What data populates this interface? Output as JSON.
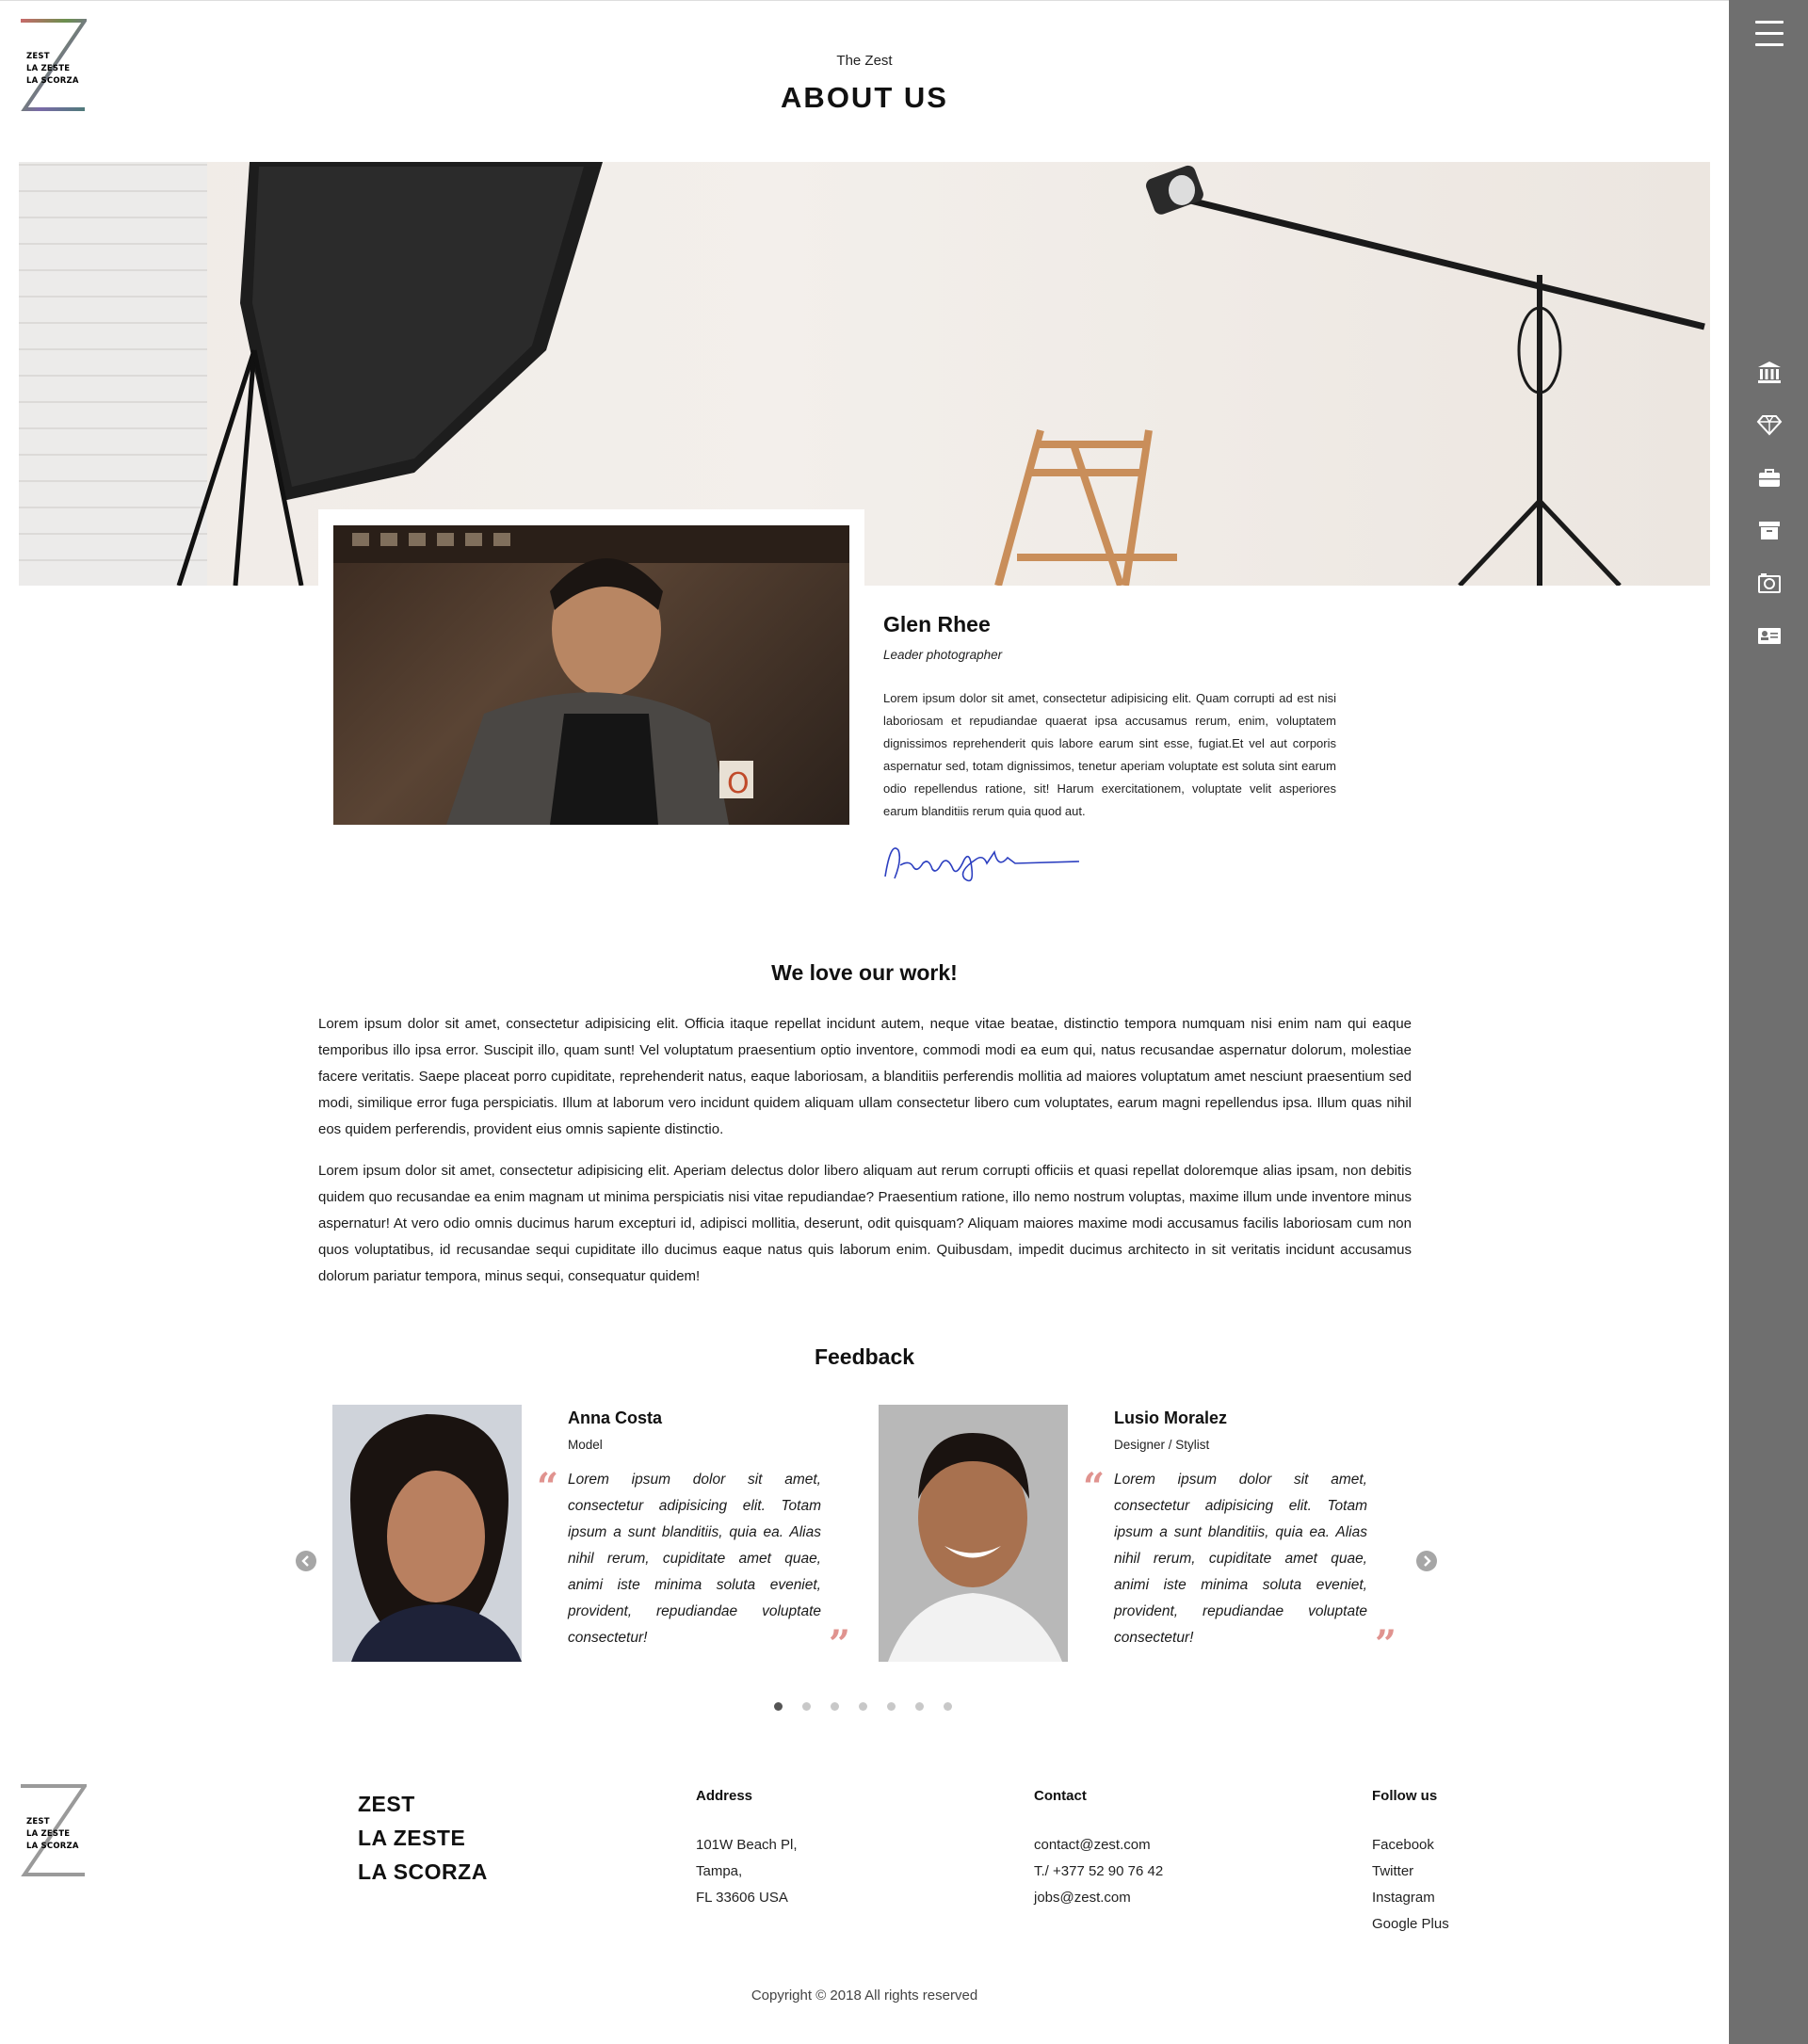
{
  "logo": {
    "line1": "ZEST",
    "line2": "LA ZESTE",
    "line3": "LA SCORZA"
  },
  "header": {
    "eyebrow": "The Zest",
    "title": "ABOUT US"
  },
  "sidebar": {
    "menu_icon": "hamburger-icon",
    "icons": [
      "bank-icon",
      "diamond-icon",
      "briefcase-icon",
      "archive-icon",
      "camera-icon",
      "id-card-icon"
    ]
  },
  "profile": {
    "name": "Glen Rhee",
    "role": "Leader photographer",
    "bio": "Lorem ipsum dolor sit amet, consectetur adipisicing elit. Quam corrupti ad est nisi laboriosam et repudiandae quaerat ipsa accusamus rerum, enim, voluptatem dignissimos reprehenderit quis labore earum sint esse, fugiat.Et vel aut corporis aspernatur sed, totam dignissimos, tenetur aperiam voluptate est soluta sint earum odio repellendus ratione, sit! Harum exercitationem, voluptate velit asperiores earum blanditiis rerum quia quod aut."
  },
  "work": {
    "heading": "We love our work!",
    "paragraph1": "Lorem ipsum dolor sit amet, consectetur adipisicing elit. Officia itaque repellat incidunt autem, neque vitae beatae, distinctio tempora numquam nisi enim nam qui eaque temporibus illo ipsa error. Suscipit illo, quam sunt! Vel voluptatum praesentium optio inventore, commodi modi ea eum qui, natus recusandae aspernatur dolorum, molestiae facere veritatis. Saepe placeat porro cupiditate, reprehenderit natus, eaque laboriosam, a blanditiis perferendis mollitia ad maiores voluptatum amet nesciunt praesentium sed modi, similique error fuga perspiciatis. Illum at laborum vero incidunt quidem aliquam ullam consectetur libero cum voluptates, earum magni repellendus ipsa. Illum quas nihil eos quidem perferendis, provident eius omnis sapiente distinctio.",
    "paragraph2": "Lorem ipsum dolor sit amet, consectetur adipisicing elit. Aperiam delectus dolor libero aliquam aut rerum corrupti officiis et quasi repellat doloremque alias ipsam, non debitis quidem quo recusandae ea enim magnam ut minima perspiciatis nisi vitae repudiandae? Praesentium ratione, illo nemo nostrum voluptas, maxime illum unde inventore minus aspernatur! At vero odio omnis ducimus harum excepturi id, adipisci mollitia, deserunt, odit quisquam? Aliquam maiores maxime modi accusamus facilis laboriosam cum non quos voluptatibus, id recusandae sequi cupiditate illo ducimus eaque natus quis laborum enim. Quibusdam, impedit ducimus architecto in sit veritatis incidunt accusamus dolorum pariatur tempora, minus sequi, consequatur quidem!"
  },
  "feedback": {
    "heading": "Feedback",
    "cards": [
      {
        "name": "Anna Costa",
        "role": "Model",
        "quote": "Lorem ipsum dolor sit amet, consectetur adipisicing elit. Totam ipsum a sunt blanditiis, quia ea. Alias nihil rerum, cupiditate amet quae, animi iste minima soluta eveniet, provident, repudiandae voluptate consectetur!"
      },
      {
        "name": "Lusio Moralez",
        "role": "Designer / Stylist",
        "quote": "Lorem ipsum dolor sit amet, consectetur adipisicing elit. Totam ipsum a sunt blanditiis, quia ea. Alias nihil rerum, cupiditate amet quae, animi iste minima soluta eveniet, provident, repudiandae voluptate consectetur!"
      }
    ],
    "prev_icon": "chevron-left-icon",
    "next_icon": "chevron-right-icon",
    "pages": 7,
    "active_page": 1
  },
  "footer": {
    "brand": [
      "ZEST",
      "LA ZESTE",
      "LA SCORZA"
    ],
    "address": {
      "title": "Address",
      "lines": [
        "101W Beach Pl,",
        "Tampa,",
        "FL 33606 USA"
      ]
    },
    "contact": {
      "title": "Contact",
      "lines": [
        "contact@zest.com",
        "T./ +377 52 90 76 42",
        "jobs@zest.com"
      ]
    },
    "follow": {
      "title": "Follow us",
      "links": [
        "Facebook",
        "Twitter",
        "Instagram",
        "Google Plus"
      ]
    },
    "copyright": "Copyright © 2018 All rights reserved"
  },
  "colors": {
    "sidebar_bg": "#6f6f6f",
    "quote_accent": "#e0938f",
    "signature": "#2c3fc0"
  }
}
